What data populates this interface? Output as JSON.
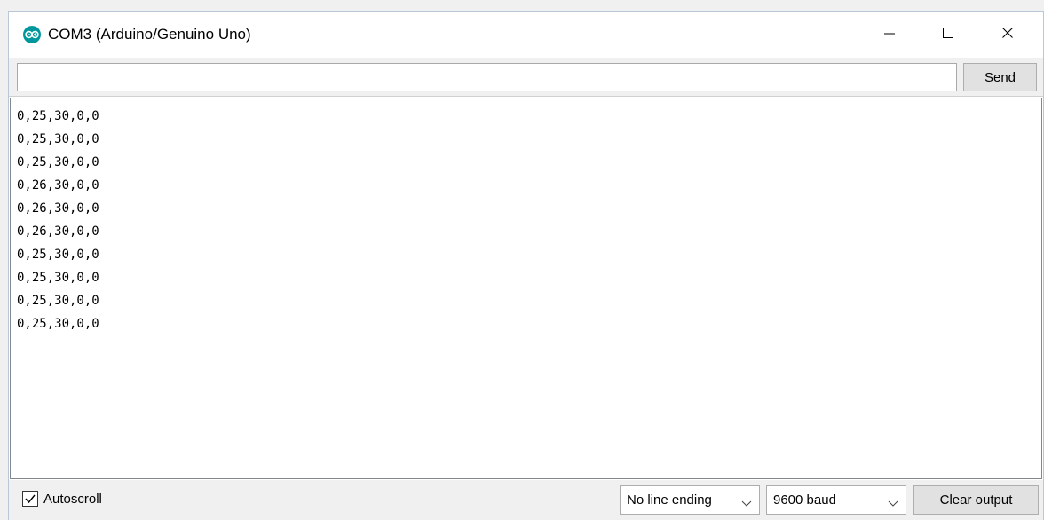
{
  "window": {
    "title": "COM3 (Arduino/Genuino Uno)",
    "icon": "arduino-logo-icon",
    "controls": {
      "minimize": "minimize-icon",
      "maximize": "maximize-icon",
      "close": "close-icon"
    }
  },
  "send": {
    "value": "",
    "button_label": "Send"
  },
  "output": {
    "lines": [
      "0,25,30,0,0",
      "0,25,30,0,0",
      "0,25,30,0,0",
      "0,26,30,0,0",
      "0,26,30,0,0",
      "0,26,30,0,0",
      "0,25,30,0,0",
      "0,25,30,0,0",
      "0,25,30,0,0",
      "0,25,30,0,0"
    ]
  },
  "footer": {
    "autoscroll_label": "Autoscroll",
    "autoscroll_checked": true,
    "line_ending": "No line ending",
    "baud": "9600 baud",
    "clear_label": "Clear output"
  },
  "colors": {
    "arduino_teal": "#00979c",
    "button_bg": "#e1e1e1",
    "panel_bg": "#f0f0f0"
  }
}
